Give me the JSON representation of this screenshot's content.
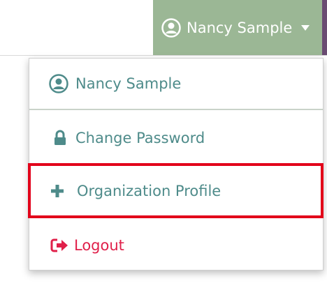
{
  "header": {
    "user_name": "Nancy Sample",
    "user_icon": "user-circle-icon",
    "caret_icon": "caret-down-icon",
    "accent_color": "#9bb795"
  },
  "menu": {
    "items": [
      {
        "label": "Nancy Sample",
        "icon": "user-circle-icon"
      },
      {
        "label": "Change Password",
        "icon": "lock-icon"
      },
      {
        "label": "Organization Profile",
        "icon": "plus-icon",
        "highlighted": true
      },
      {
        "label": "Logout",
        "icon": "sign-out-icon",
        "color": "#e0204a"
      }
    ],
    "highlight_color": "#e2001a"
  }
}
